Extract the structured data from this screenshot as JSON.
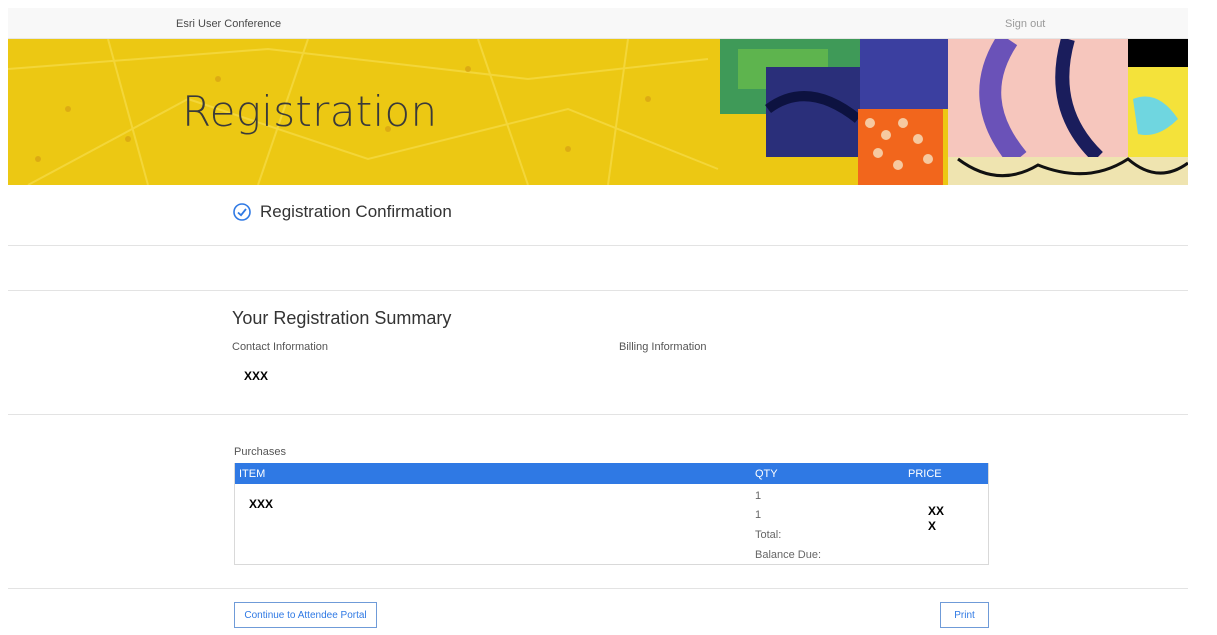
{
  "topbar": {
    "brand": "Esri User Conference",
    "signout": "Sign out"
  },
  "hero": {
    "title": "Registration"
  },
  "confirmation": {
    "text": "Registration Confirmation",
    "icon": "check-circle-icon"
  },
  "summary": {
    "title": "Your Registration Summary",
    "contact_label": "Contact Information",
    "billing_label": "Billing Information",
    "contact_value": "XXX"
  },
  "purchases": {
    "label": "Purchases",
    "headers": {
      "item": "ITEM",
      "qty": "QTY",
      "price": "PRICE"
    },
    "item_value": "XXX",
    "qty": [
      "1",
      "1"
    ],
    "total_label": "Total:",
    "balance_label": "Balance Due:",
    "price_line1": "XX",
    "price_line2": "X"
  },
  "actions": {
    "continue": "Continue to Attendee Portal",
    "print": "Print"
  },
  "colors": {
    "accent": "#2f79e4",
    "hero_yellow": "#ecc813"
  }
}
